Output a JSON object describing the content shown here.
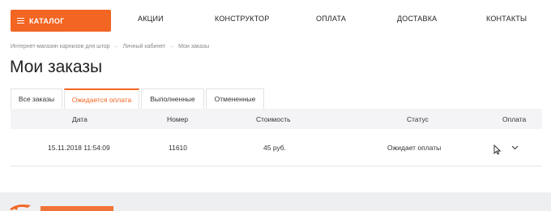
{
  "nav": {
    "catalog_label": "КАТАЛОГ",
    "links": [
      "АКЦИИ",
      "КОНСТРУКТОР",
      "ОПЛАТА",
      "ДОСТАВКА",
      "КОНТАКТЫ"
    ]
  },
  "breadcrumb": [
    "Интернет-магазин карнизов для штор",
    "Личный кабинет",
    "Мои заказы"
  ],
  "breadcrumb_separator": "–",
  "page_title": "Мои заказы",
  "tabs": [
    "Все заказы",
    "Ожидается оплата",
    "Выполненные",
    "Отмененные"
  ],
  "active_tab_index": 1,
  "table": {
    "headers": [
      "Дата",
      "Номер",
      "Стоимость",
      "Статус",
      "Оплата"
    ],
    "rows": [
      {
        "date": "15.11.2018 11:54:09",
        "number": "11610",
        "cost": "45 руб.",
        "status": "Ожидает оплаты"
      }
    ]
  },
  "colors": {
    "accent": "#f26522",
    "header_bg": "#f4f4f6",
    "footer_bg": "#eeeff1"
  }
}
